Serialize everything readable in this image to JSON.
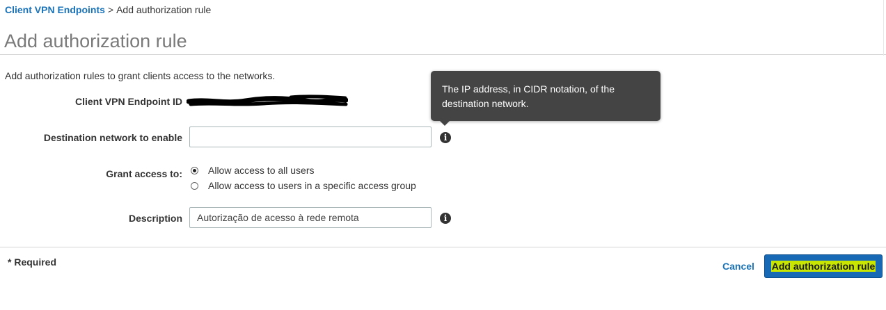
{
  "breadcrumb": {
    "parent": "Client VPN Endpoints",
    "separator": ">",
    "current": "Add authorization rule"
  },
  "page": {
    "title": "Add authorization rule",
    "intro": "Add authorization rules to grant clients access to the networks."
  },
  "form": {
    "endpoint_id_label": "Client VPN Endpoint ID",
    "destination_label": "Destination network to enable",
    "destination_value": "",
    "destination_placeholder": "",
    "grant_label": "Grant access to:",
    "grant_options": [
      {
        "label": "Allow access to all users",
        "selected": true
      },
      {
        "label": "Allow access to users in a specific access group",
        "selected": false
      }
    ],
    "description_label": "Description",
    "description_value": "Autorização de acesso à rede remota",
    "info_icon": "info-icon"
  },
  "tooltip": {
    "text": "The IP address, in CIDR notation, of the destination network."
  },
  "footer": {
    "required_note": "* Required",
    "cancel_label": "Cancel",
    "submit_label": "Add authorization rule"
  },
  "colors": {
    "link": "#1a73b8",
    "primary_button": "#1769b5",
    "highlight": "#c8e600",
    "tooltip_bg": "#444444"
  }
}
